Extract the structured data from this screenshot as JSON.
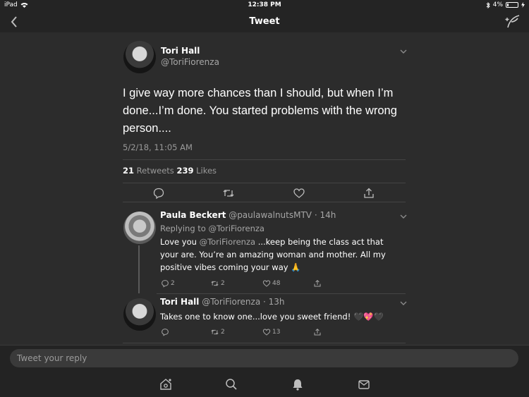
{
  "status_bar": {
    "device": "iPad",
    "time": "12:38 PM",
    "battery": "4%"
  },
  "nav": {
    "title": "Tweet"
  },
  "main_tweet": {
    "name": "Tori Hall",
    "handle": "@ToriFiorenza",
    "text": "I give way more chances than I should, but when I’m done...I’m done. You started problems  with the wrong person....",
    "timestamp": "5/2/18, 11:05 AM",
    "retweets_count": "21",
    "retweets_label": "Retweets",
    "likes_count": "239",
    "likes_label": "Likes"
  },
  "replies": [
    {
      "name": "Paula Beckert",
      "handle": "@paulawalnutsMTV",
      "time": "· 14h",
      "replying_prefix": "Replying to",
      "replying_handle": "@ToriFiorenza",
      "text_mention": "@ToriFiorenza",
      "text_pre": "Love you ",
      "text_post": " ...keep being the class act that your are.  You’re an amazing woman and mother.  All my positive vibes coming your way 🙏",
      "reply_count": "2",
      "retweet_count": "2",
      "like_count": "48"
    },
    {
      "name": "Tori Hall",
      "handle": "@ToriFiorenza",
      "time": "· 13h",
      "text": "Takes one to know one...love you sweet friend! 🖤💖🖤",
      "reply_count": "",
      "retweet_count": "2",
      "like_count": "13"
    }
  ],
  "compose": {
    "placeholder": "Tweet your reply"
  },
  "tabs": [
    "home-icon",
    "search-icon",
    "bell-icon",
    "mail-icon"
  ],
  "colors": {
    "background": "#2c2c2c",
    "bar": "#242424",
    "text": "#ffffff",
    "muted": "#a6a6a6"
  }
}
